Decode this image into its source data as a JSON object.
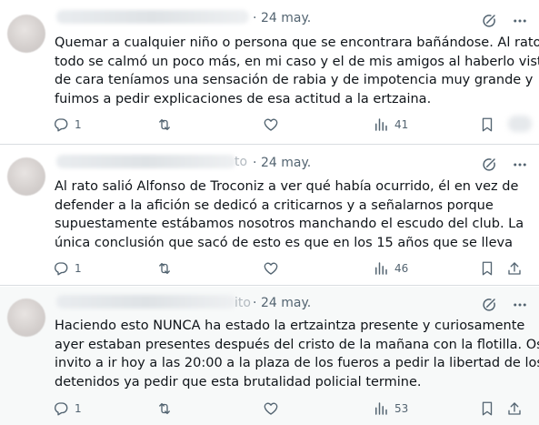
{
  "tweets": [
    {
      "date": "24 may.",
      "name_suffix": "",
      "lines": [
        "Quemar a cualquier niño o persona que se encontrara bañándose. Al rato",
        "todo se calmó un poco más, en mi caso y el de mis amigos al haberlo visto",
        "de cara teníamos una sensación de rabia y de impotencia muy grande y",
        "fuimos a pedir explicaciones de esa actitud a la ertzaina."
      ],
      "replies": "1",
      "retweets": "",
      "likes": "",
      "views": "41"
    },
    {
      "date": "24 may.",
      "name_suffix": "to",
      "lines": [
        "Al rato salió Alfonso de Troconiz a ver qué había ocurrido, él en vez de",
        "defender a la afición se dedicó a criticarnos y a señalarnos porque",
        "supuestamente estábamos nosotros manchando el escudo del club. La",
        "única conclusión que sacó de esto es que en los 15 años que se lleva"
      ],
      "replies": "1",
      "retweets": "",
      "likes": "",
      "views": "46"
    },
    {
      "date": "24 may.",
      "name_suffix": "ito",
      "lines": [
        "Haciendo esto NUNCA ha estado la ertzaintza presente y curiosamente",
        "ayer estaban presentes  después del cristo de la mañana con la flotilla. Os",
        "invito a ir hoy a las 20:00 a la plaza de los fueros a pedir la libertad de los",
        "detenidos ya pedir que esta brutalidad policial termine."
      ],
      "replies": "1",
      "retweets": "",
      "likes": "",
      "views": "53"
    }
  ],
  "meta_separator": "·",
  "icons": {
    "reply": "reply-icon",
    "retweet": "retweet-icon",
    "like": "heart-icon",
    "views": "views-icon",
    "bookmark": "bookmark-icon",
    "share": "share-icon",
    "grok": "grok-icon",
    "more": "more-icon"
  },
  "colors": {
    "text": "#0f1419",
    "muted": "#536471",
    "divider": "#d9dde1",
    "highlight_bg": "#f7f9f9"
  }
}
